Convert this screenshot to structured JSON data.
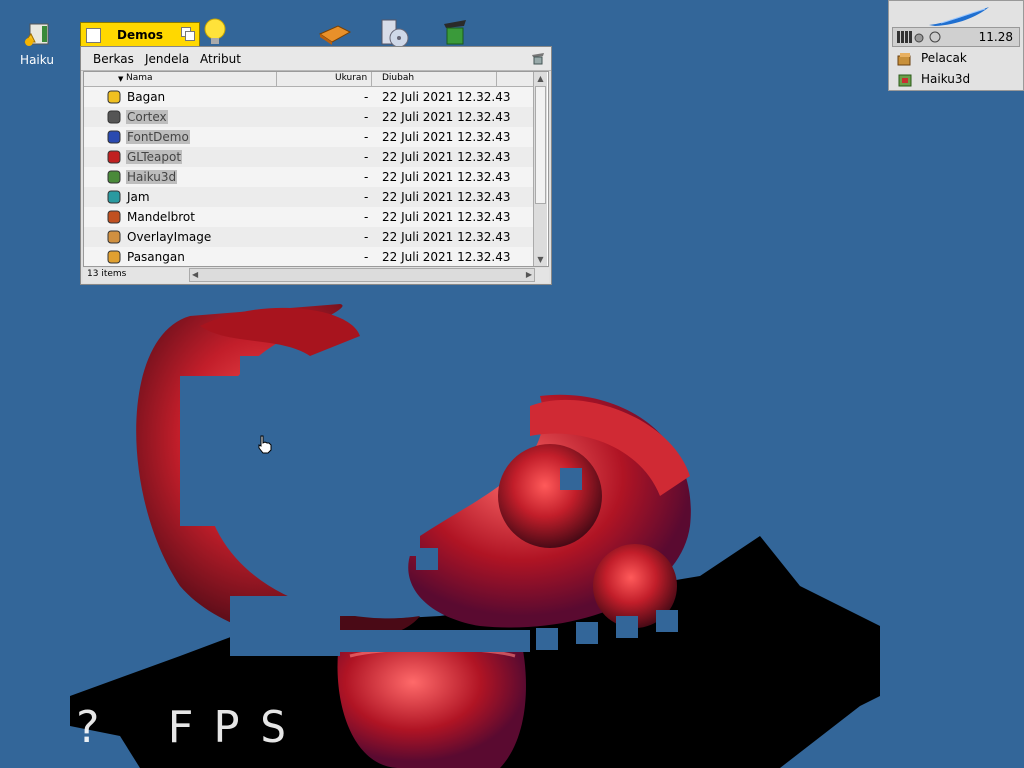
{
  "desktop": {
    "haiku_label": "Haiku"
  },
  "window": {
    "title": "Demos",
    "menu": [
      "Berkas",
      "Jendela",
      "Atribut"
    ],
    "columns": {
      "name": "Nama",
      "size": "Ukuran",
      "modified": "Diubah"
    },
    "rows": [
      {
        "name": "Bagan",
        "size": "-",
        "modified": "22 Juli 2021 12.32.43",
        "selected": false,
        "icon": "chart-app-icon"
      },
      {
        "name": "Cortex",
        "size": "-",
        "modified": "22 Juli 2021 12.32.43",
        "selected": true,
        "icon": "cortex-app-icon"
      },
      {
        "name": "FontDemo",
        "size": "-",
        "modified": "22 Juli 2021 12.32.43",
        "selected": true,
        "icon": "fontdemo-app-icon"
      },
      {
        "name": "GLTeapot",
        "size": "-",
        "modified": "22 Juli 2021 12.32.43",
        "selected": true,
        "icon": "glteapot-app-icon"
      },
      {
        "name": "Haiku3d",
        "size": "-",
        "modified": "22 Juli 2021 12.32.43",
        "selected": true,
        "icon": "haiku3d-app-icon"
      },
      {
        "name": "Jam",
        "size": "-",
        "modified": "22 Juli 2021 12.32.43",
        "selected": false,
        "icon": "clock-app-icon"
      },
      {
        "name": "Mandelbrot",
        "size": "-",
        "modified": "22 Juli 2021 12.32.43",
        "selected": false,
        "icon": "mandelbrot-app-icon"
      },
      {
        "name": "OverlayImage",
        "size": "-",
        "modified": "22 Juli 2021 12.32.43",
        "selected": false,
        "icon": "overlayimage-app-icon"
      },
      {
        "name": "Pasangan",
        "size": "-",
        "modified": "22 Juli 2021 12.32.43",
        "selected": false,
        "icon": "pairs-app-icon"
      }
    ],
    "status": "13 items"
  },
  "deskbar": {
    "clock": "11.28",
    "items": [
      {
        "label": "Pelacak",
        "icon": "tracker-icon"
      },
      {
        "label": "Haiku3d",
        "icon": "haiku3d-icon"
      }
    ]
  },
  "scene": {
    "fps_text": "? FPS"
  }
}
